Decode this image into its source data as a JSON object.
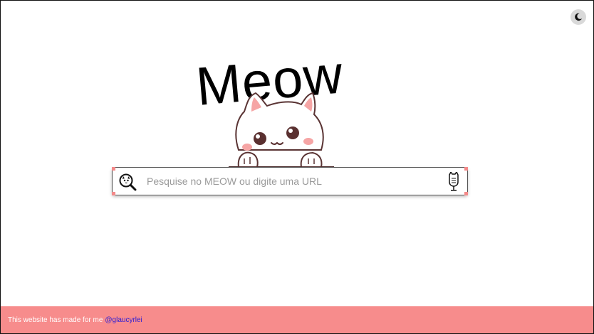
{
  "header": {
    "theme_toggle_icon": "moon-icon"
  },
  "logo": {
    "text": "Meow"
  },
  "mascot": {
    "icon": "cat-mascot"
  },
  "search": {
    "placeholder": "Pesquise no MEOW ou digite uma URL",
    "value": "",
    "search_icon": "cat-magnifier-icon",
    "voice_icon": "cat-microphone-icon",
    "accent": "#f48a8a"
  },
  "footer": {
    "text": "This website has made for me",
    "link_label": "@glaucyrlei",
    "background": "#f78c8c",
    "link_color": "#2a1bd6"
  }
}
